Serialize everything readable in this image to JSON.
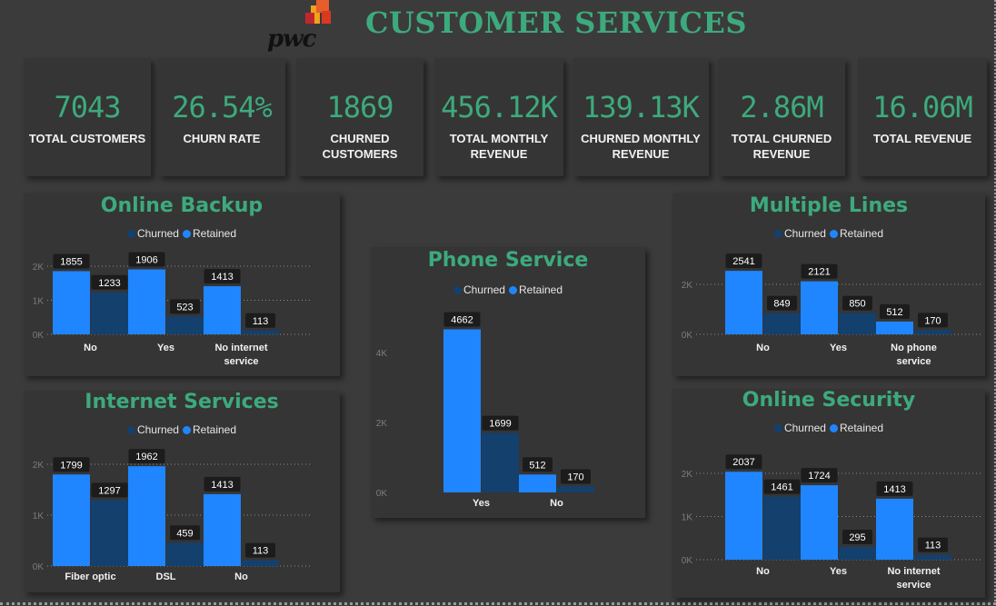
{
  "header": {
    "title": "CUSTOMER SERVICES",
    "logo_text": "pwc"
  },
  "colors": {
    "background": "#3b3b3b",
    "panel": "#353535",
    "accent": "#3daa7d",
    "churned": "#14406e",
    "retained": "#1f86ff"
  },
  "kpis": [
    {
      "value": "7043",
      "label": "TOTAL CUSTOMERS"
    },
    {
      "value": "26.54%",
      "label": "CHURN RATE"
    },
    {
      "value": "1869",
      "label": "CHURNED CUSTOMERS"
    },
    {
      "value": "456.12K",
      "label": "TOTAL MONTHLY REVENUE"
    },
    {
      "value": "139.13K",
      "label": "CHURNED MONTHLY REVENUE"
    },
    {
      "value": "2.86M",
      "label": "TOTAL CHURNED REVENUE"
    },
    {
      "value": "16.06M",
      "label": "TOTAL REVENUE"
    }
  ],
  "chart_data": [
    {
      "type": "bar",
      "title": "Online Backup",
      "categories": [
        "No",
        "Yes",
        "No internet service"
      ],
      "series": [
        {
          "name": "Churned",
          "values": [
            1233,
            523,
            113
          ]
        },
        {
          "name": "Retained",
          "values": [
            1855,
            1906,
            1413
          ]
        }
      ],
      "y_ticks": [
        "0K",
        "1K",
        "2K"
      ],
      "ylim": [
        0,
        2000
      ],
      "grid": true,
      "legend": "top-center"
    },
    {
      "type": "bar",
      "title": "Internet Services",
      "categories": [
        "Fiber optic",
        "DSL",
        "No"
      ],
      "series": [
        {
          "name": "Churned",
          "values": [
            1297,
            459,
            113
          ]
        },
        {
          "name": "Retained",
          "values": [
            1799,
            1962,
            1413
          ]
        }
      ],
      "y_ticks": [
        "0K",
        "1K",
        "2K"
      ],
      "ylim": [
        0,
        2000
      ],
      "grid": true,
      "legend": "top-center"
    },
    {
      "type": "bar",
      "title": "Phone Service",
      "categories": [
        "Yes",
        "No"
      ],
      "series": [
        {
          "name": "Churned",
          "values": [
            1699,
            170
          ]
        },
        {
          "name": "Retained",
          "values": [
            4662,
            512
          ]
        }
      ],
      "y_ticks": [
        "0K",
        "2K",
        "4K"
      ],
      "ylim": [
        0,
        4000
      ],
      "grid": false,
      "legend": "top-center"
    },
    {
      "type": "bar",
      "title": "Multiple Lines",
      "categories": [
        "No",
        "Yes",
        "No phone service"
      ],
      "series": [
        {
          "name": "Churned",
          "values": [
            849,
            850,
            170
          ]
        },
        {
          "name": "Retained",
          "values": [
            2541,
            2121,
            512
          ]
        }
      ],
      "y_ticks": [
        "0K",
        "2K"
      ],
      "ylim": [
        0,
        2000
      ],
      "grid": true,
      "legend": "top-center"
    },
    {
      "type": "bar",
      "title": "Online Security",
      "categories": [
        "No",
        "Yes",
        "No internet service"
      ],
      "series": [
        {
          "name": "Churned",
          "values": [
            1461,
            295,
            113
          ]
        },
        {
          "name": "Retained",
          "values": [
            2037,
            1724,
            1413
          ]
        }
      ],
      "y_ticks": [
        "0K",
        "1K",
        "2K"
      ],
      "ylim": [
        0,
        2000
      ],
      "grid": true,
      "legend": "top-center"
    }
  ]
}
